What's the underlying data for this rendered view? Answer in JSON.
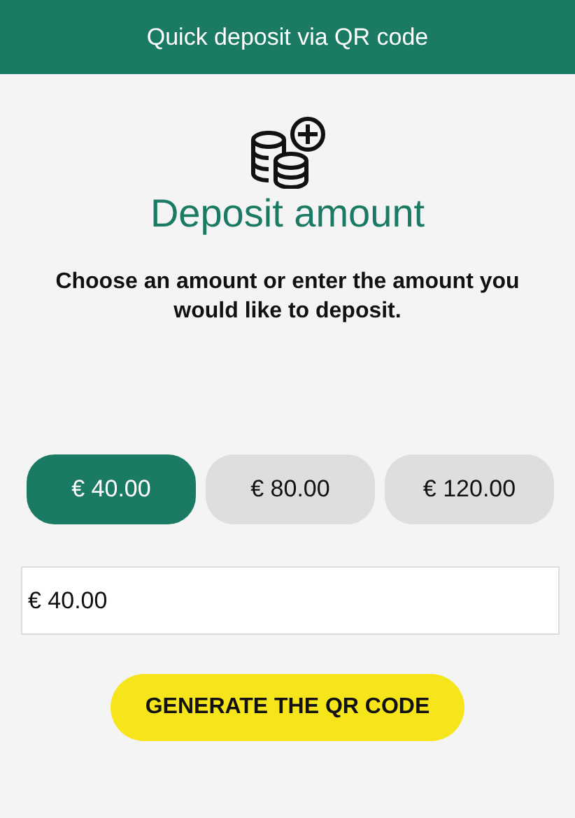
{
  "header": {
    "title": "Quick deposit via QR code"
  },
  "heading": "Deposit amount",
  "instructions": "Choose an amount or enter the amount you would like to deposit.",
  "amounts": [
    {
      "label": "€ 40.00",
      "selected": true
    },
    {
      "label": "€ 80.00",
      "selected": false
    },
    {
      "label": "€ 120.00",
      "selected": false
    }
  ],
  "amount_field": {
    "value": "€ 40.00"
  },
  "generate_button": "GENERATE THE QR CODE"
}
